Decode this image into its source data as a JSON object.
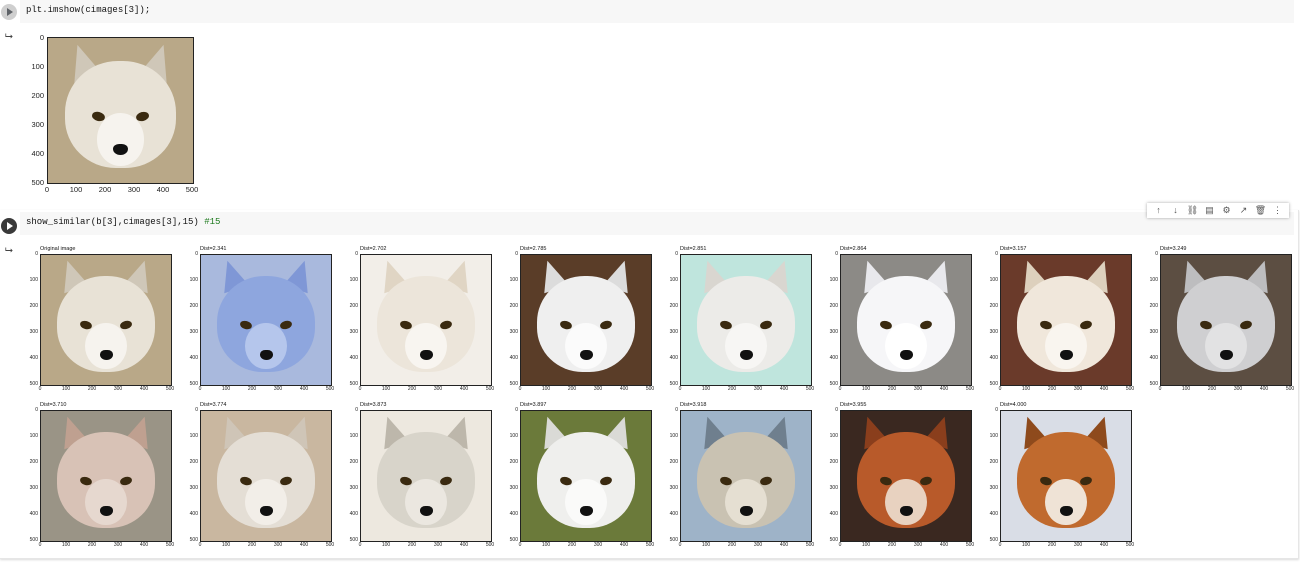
{
  "cells": [
    {
      "code": "plt.imshow(cimages[3]);",
      "output": {
        "y_ticks": [
          "0",
          "100",
          "200",
          "300",
          "400",
          "500"
        ],
        "x_ticks": [
          "0",
          "100",
          "200",
          "300",
          "400",
          "500"
        ]
      }
    },
    {
      "code": "show_similar(b[3],cimages[3],15)",
      "comment": "#15",
      "small_y_ticks": [
        "0",
        "100",
        "200",
        "300",
        "400",
        "500"
      ],
      "small_x_ticks": [
        "0",
        "100",
        "200",
        "300",
        "400",
        "500"
      ],
      "images": [
        {
          "title": "Original image",
          "bg": "#b9a888",
          "fur": "#e8e2d6",
          "muzzle": "#f6f3ee",
          "ear": "#cfc7b8"
        },
        {
          "title": "Dist=2.341",
          "bg": "#a9b9dd",
          "fur": "#8ea6de",
          "muzzle": "#b5c6ec",
          "ear": "#7f97d6"
        },
        {
          "title": "Dist=2.702",
          "bg": "#f2eee8",
          "fur": "#ece5da",
          "muzzle": "#f8f5f0",
          "ear": "#e0d5c4"
        },
        {
          "title": "Dist=2.785",
          "bg": "#5a3d28",
          "fur": "#efefef",
          "muzzle": "#fbfbfb",
          "ear": "#dcdcdc"
        },
        {
          "title": "Dist=2.851",
          "bg": "#bfe5dd",
          "fur": "#ecebe8",
          "muzzle": "#f7f6f4",
          "ear": "#d9d6d0"
        },
        {
          "title": "Dist=2.864",
          "bg": "#8c8a86",
          "fur": "#f6f6f8",
          "muzzle": "#ffffff",
          "ear": "#e8e8ec"
        },
        {
          "title": "Dist=3.157",
          "bg": "#6a3a2a",
          "fur": "#f0e7db",
          "muzzle": "#f9f5ef",
          "ear": "#ddd0bd"
        },
        {
          "title": "Dist=3.249",
          "bg": "#5c4e42",
          "fur": "#cfcfd1",
          "muzzle": "#e2e2e3",
          "ear": "#bdbdbf"
        },
        {
          "title": "Dist=3.710",
          "bg": "#9a9486",
          "fur": "#d8c2b6",
          "muzzle": "#e6d8cf",
          "ear": "#bfa090"
        },
        {
          "title": "Dist=3.774",
          "bg": "#c9b7a0",
          "fur": "#e4ded5",
          "muzzle": "#f2eee8",
          "ear": "#cfc5b7"
        },
        {
          "title": "Dist=3.873",
          "bg": "#ede8df",
          "fur": "#d8d4ca",
          "muzzle": "#ebe7e0",
          "ear": "#bdb7ab"
        },
        {
          "title": "Dist=3.897",
          "bg": "#6b7a3a",
          "fur": "#efefed",
          "muzzle": "#fafaf9",
          "ear": "#dadad6"
        },
        {
          "title": "Dist=3.918",
          "bg": "#9eb3c8",
          "fur": "#c9c2b2",
          "muzzle": "#e5dfd2",
          "ear": "#6f7f8e"
        },
        {
          "title": "Dist=3.955",
          "bg": "#3a2820",
          "fur": "#b85a2a",
          "muzzle": "#e8d2c0",
          "ear": "#8a3e1c"
        },
        {
          "title": "Dist=4.000",
          "bg": "#d9dde6",
          "fur": "#c06a2e",
          "muzzle": "#efe3d6",
          "ear": "#8e4a1c"
        }
      ]
    }
  ],
  "toolbar": [
    {
      "name": "move-up-icon",
      "glyph": "↑"
    },
    {
      "name": "move-down-icon",
      "glyph": "↓"
    },
    {
      "name": "link-icon",
      "glyph": "⛓"
    },
    {
      "name": "comment-icon",
      "glyph": "▤"
    },
    {
      "name": "settings-icon",
      "glyph": "⚙"
    },
    {
      "name": "open-in-icon",
      "glyph": "↗"
    },
    {
      "name": "delete-icon",
      "glyph": "🗑"
    },
    {
      "name": "more-icon",
      "glyph": "⋮"
    }
  ],
  "output_glyph": "⮡",
  "colors": {
    "eye": "#3a2a10",
    "nose": "#111111",
    "frame": "#222222"
  }
}
